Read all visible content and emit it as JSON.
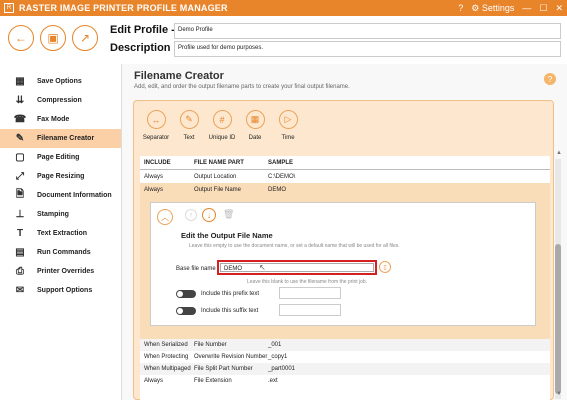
{
  "titlebar": {
    "title": "RASTER IMAGE PRINTER PROFILE MANAGER",
    "settings": "⚙ Settings",
    "help": "?",
    "minimize": "—",
    "maximize": "☐",
    "close": "✕"
  },
  "header": {
    "edit_profile_label": "Edit Profile -",
    "description_label": "Description",
    "profile_name": "Demo Profile",
    "profile_description": "Profile used for demo purposes."
  },
  "sidebar": {
    "items": [
      {
        "label": "Save Options",
        "icon": "▦"
      },
      {
        "label": "Compression",
        "icon": "⇊"
      },
      {
        "label": "Fax Mode",
        "icon": "☎"
      },
      {
        "label": "Filename Creator",
        "icon": "✎"
      },
      {
        "label": "Page Editing",
        "icon": "▢"
      },
      {
        "label": "Page Resizing",
        "icon": "⤢"
      },
      {
        "label": "Document Information",
        "icon": "🗎"
      },
      {
        "label": "Stamping",
        "icon": "⊥"
      },
      {
        "label": "Text Extraction",
        "icon": "T"
      },
      {
        "label": "Run Commands",
        "icon": "▤"
      },
      {
        "label": "Printer Overrides",
        "icon": "⎙"
      },
      {
        "label": "Support Options",
        "icon": "✉"
      }
    ]
  },
  "main": {
    "title": "Filename Creator",
    "subtitle": "Add, edit, and order the output filename parts to create your final output filename.",
    "help": "?",
    "tools": [
      {
        "label": "Separator",
        "icon": "↔"
      },
      {
        "label": "Text",
        "icon": "✎"
      },
      {
        "label": "Unique ID",
        "icon": "#"
      },
      {
        "label": "Date",
        "icon": "▦"
      },
      {
        "label": "Time",
        "icon": "▷"
      }
    ],
    "columns": [
      "INCLUDE",
      "FILE NAME PART",
      "SAMPLE"
    ],
    "rows_top": [
      {
        "include": "Always",
        "part": "Output Location",
        "sample": "C:\\DEMO\\"
      },
      {
        "include": "Always",
        "part": "Output File Name",
        "sample": "DEMO"
      }
    ],
    "editor": {
      "title": "Edit the Output File Name",
      "hint": "Leave this empty to use the document name, or set a default name that will be used for all files.",
      "base_label": "Base file name",
      "base_value": "DEMO",
      "base_hint": "Leave this blank to use the filename from the print job.",
      "prefix_label": "Include this prefix text",
      "suffix_label": "Include this suffix text"
    },
    "rows_bottom": [
      {
        "include": "When Serialized",
        "part": "File Number",
        "sample": "_001"
      },
      {
        "include": "When Protecting",
        "part": "Overwrite Revision Number",
        "sample": "_copy1"
      },
      {
        "include": "When Multipaged",
        "part": "File Split Part Number",
        "sample": "_part0001"
      },
      {
        "include": "Always",
        "part": "File Extension",
        "sample": ".ext"
      }
    ]
  }
}
